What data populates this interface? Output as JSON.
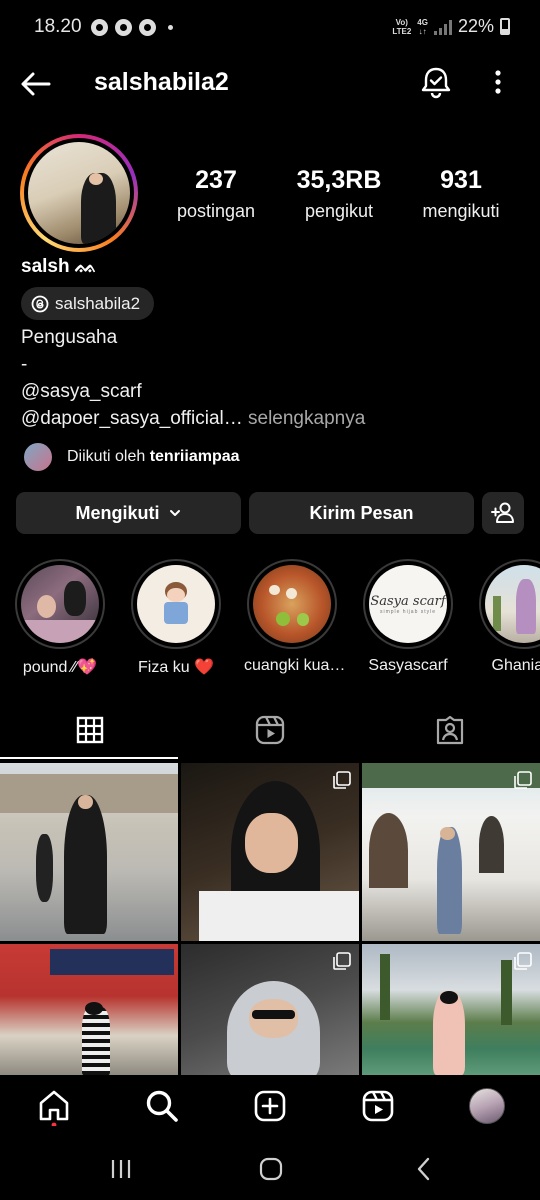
{
  "status_bar": {
    "time": "18.20",
    "network": [
      "Vo)",
      "LTE2",
      "4G"
    ],
    "battery": "22%"
  },
  "header": {
    "username": "salshabila2"
  },
  "profile": {
    "stats": [
      {
        "value": "237",
        "label": "postingan"
      },
      {
        "value": "35,3RB",
        "label": "pengikut"
      },
      {
        "value": "931",
        "label": "mengikuti"
      }
    ],
    "display_name": "salsh ᨐ",
    "threads_handle": "salshabila2",
    "bio": {
      "line1": "Pengusaha",
      "line2": "-",
      "line3": "@sasya_scarf",
      "line4": "@dapoer_sasya_official…",
      "more": " selengkapnya"
    },
    "followed_by_prefix": "Diikuti oleh ",
    "followed_by_name": "tenriiampaa"
  },
  "actions": {
    "following": "Mengikuti",
    "message": "Kirim Pesan"
  },
  "highlights": [
    {
      "label": "pound ⁄⁄💖"
    },
    {
      "label": "Fiza ku ❤️"
    },
    {
      "label": "cuangki kua…"
    },
    {
      "label": "Sasyascarf"
    },
    {
      "label": "Ghania o"
    }
  ],
  "highlight_logo_text": "Sasya scarf",
  "highlight_logo_subtext": "simple hijab style",
  "icons": {
    "back": "arrow-left-icon",
    "bell": "bell-check-icon",
    "menu": "more-vertical-icon",
    "grid": "grid-icon",
    "reels": "reels-icon",
    "tagged": "tagged-icon",
    "home": "home-icon",
    "search": "search-icon",
    "create": "plus-square-icon",
    "reels_nav": "reels-icon",
    "profile": "profile-avatar"
  }
}
